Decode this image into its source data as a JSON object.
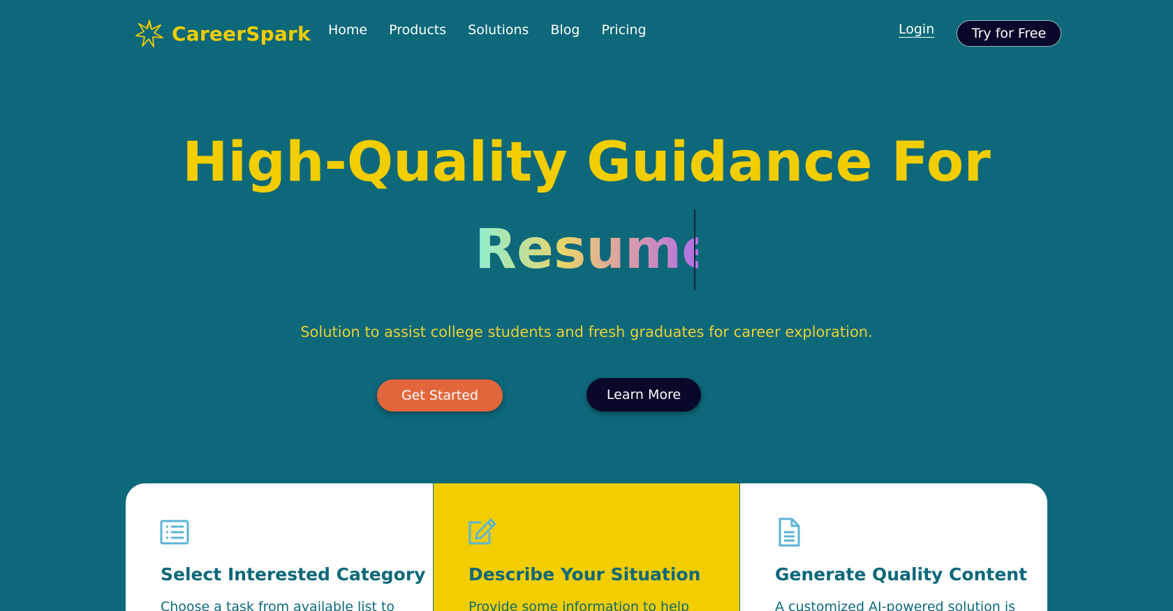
{
  "brand": {
    "name": "CareerSpark",
    "icon": "spark-star-logo-icon",
    "color": "#f2cd00"
  },
  "nav": {
    "links": [
      {
        "label": "Home"
      },
      {
        "label": "Products"
      },
      {
        "label": "Solutions"
      },
      {
        "label": "Blog"
      },
      {
        "label": "Pricing"
      }
    ],
    "login_label": "Login",
    "try_label": "Try for Free"
  },
  "hero": {
    "title": "High-Quality Guidance For",
    "typed_word": "Resume",
    "subtitle": "Solution to assist college students and fresh graduates for career exploration.",
    "primary_cta": "Get Started",
    "secondary_cta": "Learn More"
  },
  "colors": {
    "background": "#0d6879",
    "accent_yellow": "#f2cd00",
    "cta_orange": "#e2663b",
    "dark_navy": "#07082a"
  },
  "steps": [
    {
      "icon": "list-icon",
      "title": "Select Interested Category",
      "description": "Choose a task from available list to"
    },
    {
      "icon": "edit-icon",
      "title": "Describe Your Situation",
      "description": "Provide some information to help"
    },
    {
      "icon": "document-icon",
      "title": "Generate Quality Content",
      "description": "A customized AI-powered solution is"
    }
  ]
}
